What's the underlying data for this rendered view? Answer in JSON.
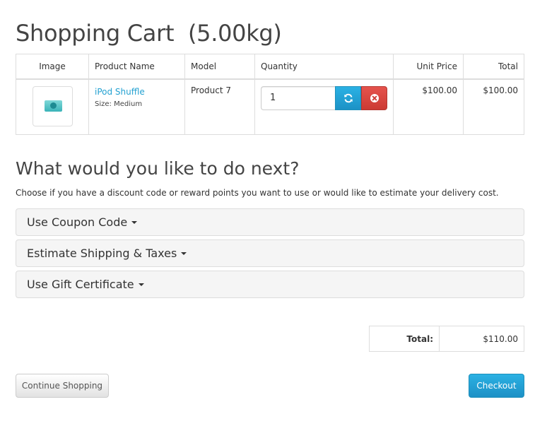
{
  "page": {
    "title": "Shopping Cart  (5.00kg)"
  },
  "cart_table": {
    "headers": {
      "image": "Image",
      "product_name": "Product Name",
      "model": "Model",
      "quantity": "Quantity",
      "unit_price": "Unit Price",
      "total": "Total"
    },
    "rows": [
      {
        "product_name": "iPod Shuffle",
        "option": "Size: Medium",
        "model": "Product 7",
        "quantity": "1",
        "unit_price": "$100.00",
        "total": "$100.00",
        "thumbnail_icon": "ipod-shuffle-thumbnail"
      }
    ]
  },
  "next_section": {
    "heading": "What would you like to do next?",
    "description": "Choose if you have a discount code or reward points you want to use or would like to estimate your delivery cost.",
    "panels": [
      {
        "label": "Use Coupon Code",
        "icon": "caret-down-icon"
      },
      {
        "label": "Estimate Shipping & Taxes",
        "icon": "caret-down-icon"
      },
      {
        "label": "Use Gift Certificate",
        "icon": "caret-down-icon"
      }
    ]
  },
  "totals": {
    "label": "Total:",
    "value": "$110.00"
  },
  "buttons": {
    "continue": "Continue Shopping",
    "checkout": "Checkout",
    "update_icon": "refresh-icon",
    "remove_icon": "remove-circle-icon"
  },
  "colors": {
    "link": "#23a1d1",
    "primary": "#229ac8",
    "danger": "#da4f49"
  }
}
